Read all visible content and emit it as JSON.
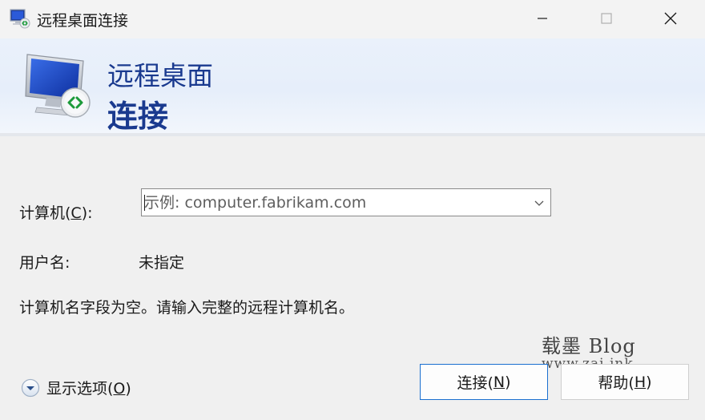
{
  "window": {
    "title": "远程桌面连接",
    "icon": "remote-desktop-icon"
  },
  "banner": {
    "line1": "远程桌面",
    "line2": "连接",
    "icon": "monitor-remote-icon",
    "brand_color": "#1a3a8f"
  },
  "form": {
    "computer": {
      "label_prefix": "计算机(",
      "label_key": "C",
      "label_suffix": "):",
      "placeholder": "示例: computer.fabrikam.com",
      "value": ""
    },
    "username": {
      "label": "用户名:",
      "value": "未指定"
    },
    "message": "计算机名字段为空。请输入完整的远程计算机名。"
  },
  "watermark": {
    "line1": "载墨 Blog",
    "line2": "www.zai.ink"
  },
  "options_toggle": {
    "label_prefix": "显示选项(",
    "label_key": "O",
    "label_suffix": ")"
  },
  "buttons": {
    "connect": {
      "prefix": "连接(",
      "key": "N",
      "suffix": ")"
    },
    "help": {
      "prefix": "帮助(",
      "key": "H",
      "suffix": ")"
    }
  },
  "colors": {
    "accent": "#1a6fd0",
    "banner_text": "#1a3a8f"
  }
}
